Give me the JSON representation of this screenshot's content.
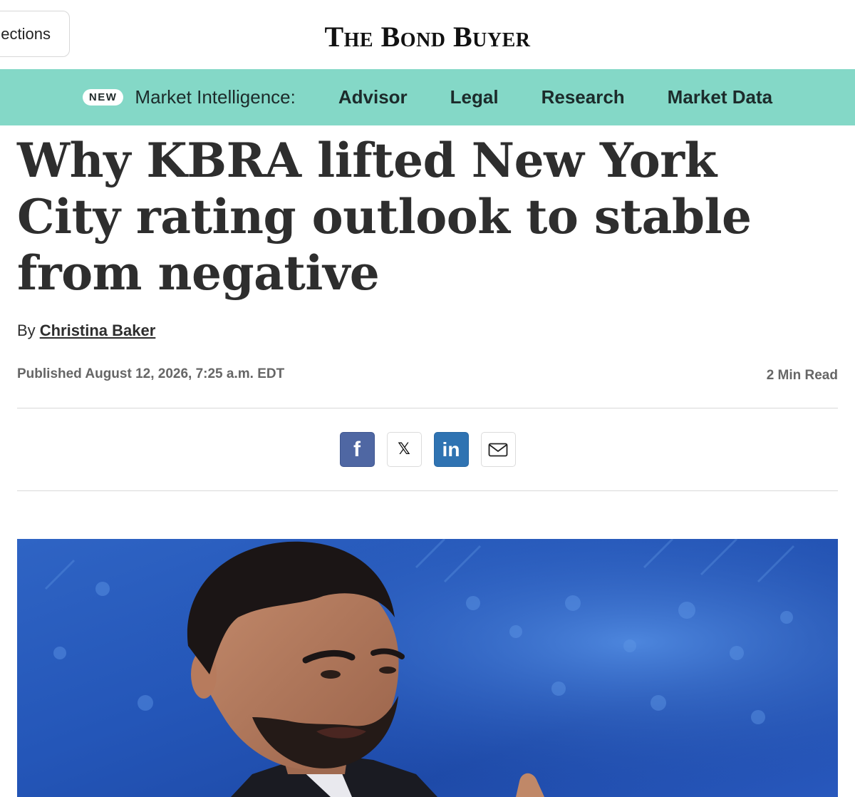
{
  "header": {
    "sections_label": "ections",
    "logo_text": "The Bond Buyer"
  },
  "market_intelligence": {
    "badge": "NEW",
    "label": "Market Intelligence:",
    "links": [
      "Advisor",
      "Legal",
      "Research",
      "Market Data"
    ]
  },
  "article": {
    "headline": "Why KBRA lifted New York City rating outlook to stable from negative",
    "byline_prefix": "By",
    "author": "Christina Baker",
    "published": "Published August 12, 2026, 7:25 a.m. EDT",
    "read_time": "2 Min Read"
  },
  "share": {
    "icons": [
      "facebook-icon",
      "x-icon",
      "linkedin-icon",
      "email-icon"
    ],
    "facebook_glyph": "f",
    "x_glyph": "𝕏",
    "linkedin_glyph": "in"
  },
  "colors": {
    "market_bar": "#84d8c7",
    "facebook": "#4f67a3",
    "linkedin": "#2f73b2",
    "hero_background": "#2456b8"
  }
}
